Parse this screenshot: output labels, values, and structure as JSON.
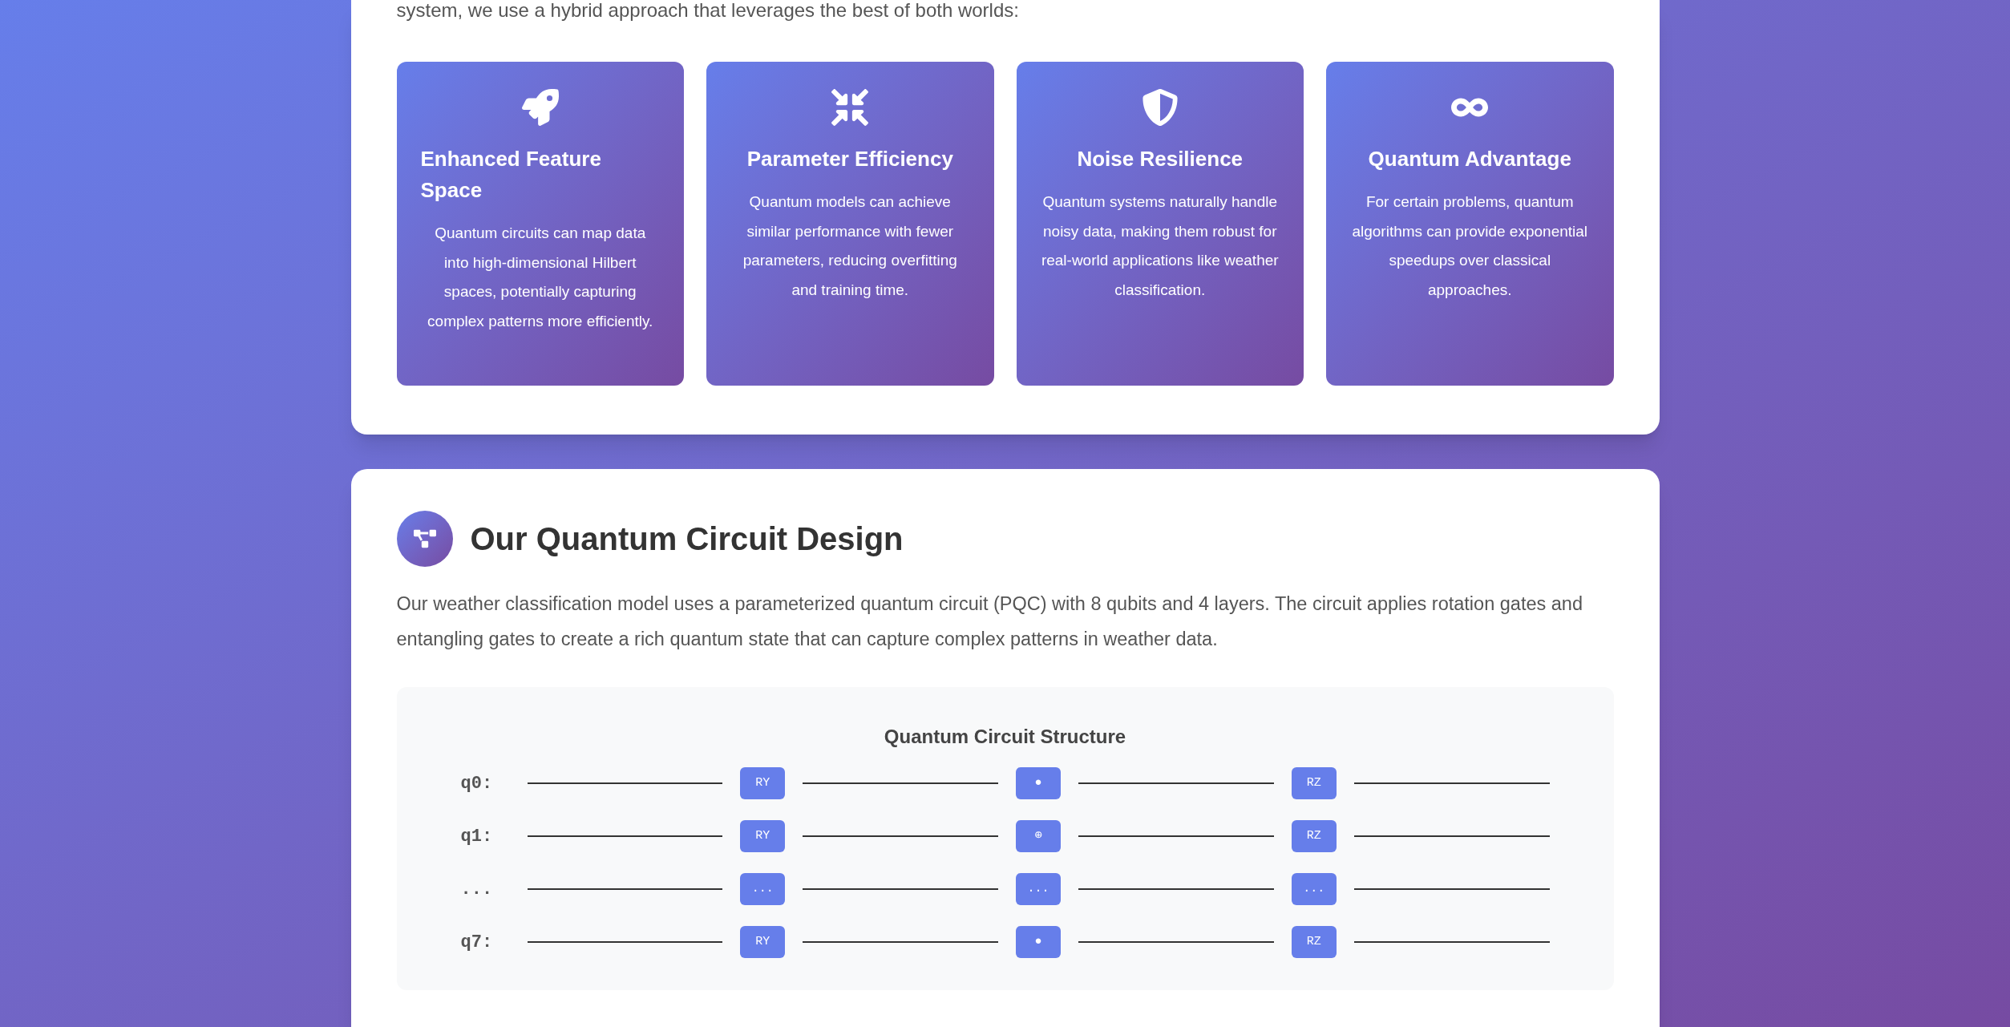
{
  "intro_tail": "system, we use a hybrid approach that leverages the best of both worlds:",
  "benefits": [
    {
      "title": "Enhanced Feature Space",
      "text": "Quantum circuits can map data into high-dimensional Hilbert spaces, potentially capturing complex patterns more efficiently."
    },
    {
      "title": "Parameter Efficiency",
      "text": "Quantum models can achieve similar performance with fewer parameters, reducing overfitting and training time."
    },
    {
      "title": "Noise Resilience",
      "text": "Quantum systems naturally handle noisy data, making them robust for real-world applications like weather classification."
    },
    {
      "title": "Quantum Advantage",
      "text": "For certain problems, quantum algorithms can provide exponential speedups over classical approaches."
    }
  ],
  "circuit_section": {
    "title": "Our Quantum Circuit Design",
    "text": "Our weather classification model uses a parameterized quantum circuit (PQC) with 8 qubits and 4 layers. The circuit applies rotation gates and entangling gates to create a rich quantum state that can capture complex patterns in weather data.",
    "diagram": {
      "title": "Quantum Circuit Structure",
      "rows": [
        {
          "label": "q0:",
          "gates": [
            "RY",
            "●",
            "RZ"
          ]
        },
        {
          "label": "q1:",
          "gates": [
            "RY",
            "⊕",
            "RZ"
          ]
        },
        {
          "label": "...",
          "gates": [
            "...",
            "...",
            "..."
          ]
        },
        {
          "label": "q7:",
          "gates": [
            "RY",
            "●",
            "RZ"
          ]
        }
      ]
    }
  }
}
